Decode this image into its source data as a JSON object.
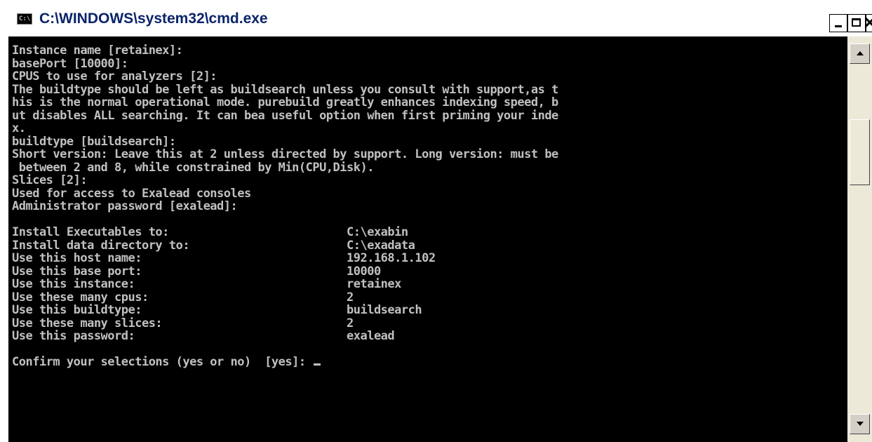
{
  "window": {
    "title": "C:\\WINDOWS\\system32\\cmd.exe",
    "icon_label": "C:\\"
  },
  "console": {
    "lines": [
      "Instance name [retainex]:",
      "basePort [10000]:",
      "CPUS to use for analyzers [2]:",
      "The buildtype should be left as buildsearch unless you consult with support,as t",
      "his is the normal operational mode. purebuild greatly enhances indexing speed, b",
      "ut disables ALL searching. It can bea useful option when first priming your inde",
      "x.",
      "buildtype [buildsearch]:",
      "Short version: Leave this at 2 unless directed by support. Long version: must be",
      " between 2 and 8, while constrained by Min(CPU,Disk).",
      "Slices [2]:",
      "Used for access to Exalead consoles",
      "Administrator password [exalead]:",
      "",
      "Install Executables to:                          C:\\exabin",
      "Install data directory to:                       C:\\exadata",
      "Use this host name:                              192.168.1.102",
      "Use this base port:                              10000",
      "Use this instance:                               retainex",
      "Use these many cpus:                             2",
      "Use this buildtype:                              buildsearch",
      "Use these many slices:                           2",
      "Use this password:                               exalead",
      "",
      "Confirm your selections (yes or no)  [yes]: "
    ]
  },
  "colors": {
    "console_background": "#000000",
    "console_text": "#c0c0c0",
    "title_text": "#0a246a"
  }
}
